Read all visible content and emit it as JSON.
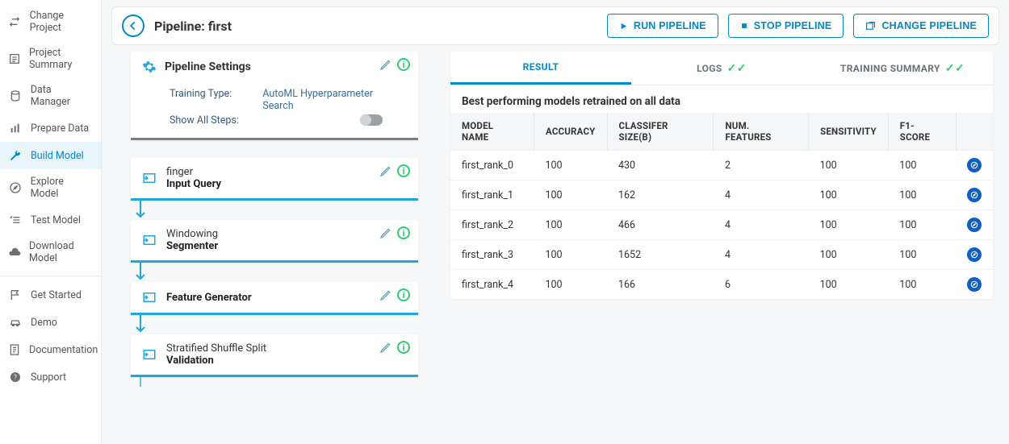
{
  "sidebar": {
    "items": [
      {
        "label": "Change Project",
        "icon": "swap"
      },
      {
        "label": "Project Summary",
        "icon": "summary"
      },
      {
        "label": "Data Manager",
        "icon": "db"
      },
      {
        "label": "Prepare Data",
        "icon": "bars"
      },
      {
        "label": "Build Model",
        "icon": "wrench",
        "active": true
      },
      {
        "label": "Explore Model",
        "icon": "compass"
      },
      {
        "label": "Test Model",
        "icon": "checklist"
      },
      {
        "label": "Download Model",
        "icon": "cloud"
      },
      {
        "sep": true
      },
      {
        "label": "Get Started",
        "icon": "flag"
      },
      {
        "label": "Demo",
        "icon": "car"
      },
      {
        "label": "Documentation",
        "icon": "doc"
      },
      {
        "label": "Support",
        "icon": "help"
      }
    ]
  },
  "header": {
    "title": "Pipeline: first",
    "run": "RUN PIPELINE",
    "stop": "STOP PIPELINE",
    "change": "CHANGE PIPELINE"
  },
  "settings": {
    "title": "Pipeline Settings",
    "training_type_label": "Training Type:",
    "training_type": "AutoML Hyperparameter Search",
    "show_all_label": "Show All Steps:",
    "show_all": false
  },
  "steps": [
    {
      "top": "finger",
      "bottom": "Input Query"
    },
    {
      "top": "Windowing",
      "bottom": "Segmenter"
    },
    {
      "top": "",
      "bottom": "Feature Generator"
    },
    {
      "top": "Stratified Shuffle Split",
      "bottom": "Validation"
    }
  ],
  "resultsTabs": {
    "result": "RESULT",
    "logs": "LOGS",
    "training": "TRAINING SUMMARY"
  },
  "results": {
    "title": "Best performing models retrained on all data",
    "columns": [
      "MODEL NAME",
      "ACCURACY",
      "CLASSIFER SIZE(B)",
      "NUM. FEATURES",
      "SENSITIVITY",
      "F1-SCORE"
    ],
    "rows": [
      {
        "name": "first_rank_0",
        "accuracy": "100",
        "size": "430",
        "features": "2",
        "sensitivity": "100",
        "f1": "100"
      },
      {
        "name": "first_rank_1",
        "accuracy": "100",
        "size": "162",
        "features": "4",
        "sensitivity": "100",
        "f1": "100"
      },
      {
        "name": "first_rank_2",
        "accuracy": "100",
        "size": "466",
        "features": "4",
        "sensitivity": "100",
        "f1": "100"
      },
      {
        "name": "first_rank_3",
        "accuracy": "100",
        "size": "1652",
        "features": "4",
        "sensitivity": "100",
        "f1": "100"
      },
      {
        "name": "first_rank_4",
        "accuracy": "100",
        "size": "166",
        "features": "6",
        "sensitivity": "100",
        "f1": "100"
      }
    ]
  }
}
